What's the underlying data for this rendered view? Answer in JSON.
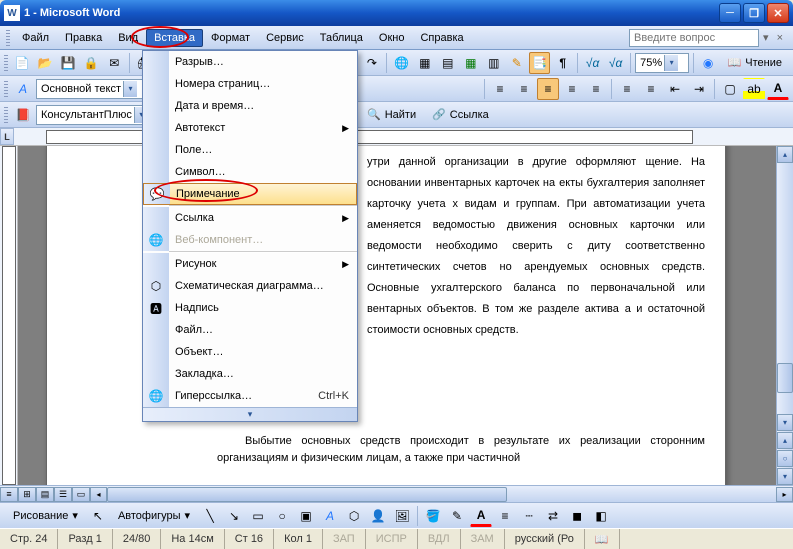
{
  "title": "1 - Microsoft Word",
  "menus": {
    "file": "Файл",
    "edit": "Правка",
    "view": "Вид",
    "insert": "Вставка",
    "format": "Формат",
    "tools": "Сервис",
    "table": "Таблица",
    "window": "Окно",
    "help": "Справка"
  },
  "question_placeholder": "Введите вопрос",
  "insert_menu": {
    "break": "Разрыв…",
    "page_numbers": "Номера страниц…",
    "date_time": "Дата и время…",
    "autotext": "Автотекст",
    "field": "Поле…",
    "symbol": "Символ…",
    "comment": "Примечание",
    "reference": "Ссылка",
    "web_component": "Веб-компонент…",
    "picture": "Рисунок",
    "diagram": "Схематическая диаграмма…",
    "textbox": "Надпись",
    "file": "Файл…",
    "object": "Объект…",
    "bookmark": "Закладка…",
    "hyperlink": "Гиперссылка…",
    "hyperlink_sc": "Ctrl+K"
  },
  "toolbar2": {
    "zoom": "75%",
    "reading": "Чтение"
  },
  "toolbar3": {
    "style_combo": "Основной текст"
  },
  "toolbar4": {
    "product": "КонсультантПлюс",
    "find": "Найти",
    "link": "Ссылка"
  },
  "doc_text": {
    "l1": "утри данной организации в другие оформляют",
    "l2": "щение. На основании инвентарных карточек на",
    "l3": "екты бухгалтерия заполняет карточку учета",
    "l4": "х видам и группам. При автоматизации учета",
    "l5": "аменяется ведомостью движения основных",
    "l6": "карточки или ведомости необходимо сверить с",
    "l7": "диту соответственно синтетических счетов",
    "l8": "но арендуемых основных средств. Основные",
    "l9": "ухгалтерского баланса по первоначальной или",
    "l10": "вентарных объектов. В том же разделе актива",
    "l11": "а и остаточной стоимости основных средств.",
    "l12": "Выбытие основных средств происходит в результате их реализации сторонним организациям и физическим лицам, а также при частичной"
  },
  "drawbar": {
    "drawing": "Рисование",
    "autoshapes": "Автофигуры"
  },
  "status": {
    "page": "Стр. 24",
    "section": "Разд 1",
    "pages": "24/80",
    "at": "На 14см",
    "line": "Ст 16",
    "col": "Кол 1",
    "rec": "ЗАП",
    "trk": "ИСПР",
    "ext": "ВДЛ",
    "ovr": "ЗАМ",
    "lang": "русский (Ро"
  }
}
